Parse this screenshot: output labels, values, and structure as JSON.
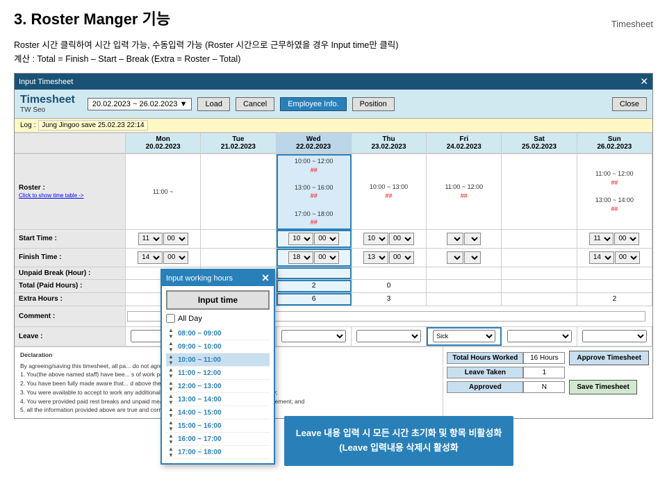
{
  "page": {
    "title": "3. Roster Manger 기능",
    "subtitle": "Timesheet",
    "desc1": "Roster 시간 클릭하여 시간 입력 가능, 수동입력 가능 (Roster 시간으로 근무하였을 경우 Input time만 클릭)",
    "desc2": "계산 : Total = Finish – Start – Break (Extra = Roster – Total)"
  },
  "window": {
    "title": "Input Timesheet",
    "ts_title": "Timesheet",
    "ts_subtitle": "TW Seo",
    "date_range": "20.02.2023 ~ 26.02.2023",
    "btn_load": "Load",
    "btn_cancel": "Cancel",
    "btn_employee": "Employee Info.",
    "btn_position": "Position",
    "btn_close": "Close",
    "log_label": "Log :",
    "log_entry": "Jung Jingoo save 25.02.23 22:14"
  },
  "days": [
    {
      "name": "Mon",
      "date": "20.02.2023"
    },
    {
      "name": "Tue",
      "date": "21.02.2023"
    },
    {
      "name": "Wed",
      "date": "22.02.2023"
    },
    {
      "name": "Thu",
      "date": "23.02.2023"
    },
    {
      "name": "Fri",
      "date": "24.02.2023"
    },
    {
      "name": "Sat",
      "date": "25.02.2023"
    },
    {
      "name": "Sun",
      "date": "26.02.2023"
    }
  ],
  "roster": {
    "label": "Roster :",
    "sublabel": "Click to show time table ->",
    "cells": [
      "11:00 ~",
      "",
      "10:00 ~ 12:00 ##\n13:00 ~ 16:00 ##\n17:00 ~ 18:00 ##",
      "10:00 ~ 13:00 ##",
      "11:00 ~ 12:00 ##",
      "",
      "11:00 ~ 12:00 ##\n13:00 ~ 14:00 ##"
    ]
  },
  "start_time": {
    "label": "Start Time :",
    "values": [
      "11",
      "",
      "10",
      "10",
      "",
      "",
      "11"
    ]
  },
  "finish_time": {
    "label": "Finish Time :",
    "values": [
      "14",
      "",
      "18",
      "13",
      "",
      "",
      "14"
    ]
  },
  "unpaid_break": {
    "label": "Unpaid Break (Hour) :",
    "values": [
      "",
      "",
      "",
      "",
      "",
      "",
      ""
    ]
  },
  "total_paid": {
    "label": "Total (Paid Hours) :",
    "values": [
      "",
      "",
      "2",
      "0",
      "",
      "",
      ""
    ]
  },
  "extra_hours": {
    "label": "Extra Hours :",
    "values": [
      "",
      "",
      "6",
      "3",
      "",
      "",
      "2"
    ]
  },
  "comment": {
    "label": "Comment :",
    "values": [
      "",
      "",
      "",
      "",
      "",
      "",
      ""
    ]
  },
  "leave": {
    "label": "Leave :",
    "values": [
      "",
      "",
      "",
      "",
      "Sick",
      "",
      ""
    ]
  },
  "popup": {
    "title": "Input working hours",
    "btn_input": "Input time",
    "checkbox_allday": "All Day",
    "times": [
      "08:00 ~ 09:00",
      "09:00 ~ 10:00",
      "10:00 ~ 11:00",
      "11:00 ~ 12:00",
      "12:00 ~ 13:00",
      "13:00 ~ 14:00",
      "14:00 ~ 15:00",
      "15:00 ~ 16:00",
      "16:00 ~ 17:00",
      "17:00 ~ 18:00"
    ],
    "highlighted_index": 2
  },
  "notice": {
    "text": "Leave 내용 입력 시 모든 시간 초기화 및 항목 비활성화\n(Leave 입력내용 삭제시 활성화"
  },
  "declaration": {
    "label": "Declaration",
    "text1": "By agreeing/saving this timesheet, all pa",
    "text2": "1. You(the above named staff) have bee",
    "text3": "2. You have been fully made aware that",
    "text4": "3. You were available to accept to work any additional hours of work that was offered to you, if any;",
    "text5": "4. You were provided paid rest breaks and unpaid meal breaks as agreed in the employment agreement; and",
    "text6": "5. all the information provided above are true and correct.",
    "text_right1": "s do not agree, please tell manager.",
    "text_right2": "s of work per week by us (the employer)",
    "text_right3": "d above the agreed hours."
  },
  "summary": {
    "total_hours_label": "Total Hours Worked",
    "total_hours_value": "16 Hours",
    "leave_taken_label": "Leave Taken",
    "leave_taken_value": "1",
    "approved_label": "Approved",
    "approved_value": "N",
    "btn_approve": "Approve Timesheet",
    "btn_save": "Save Timesheet"
  }
}
